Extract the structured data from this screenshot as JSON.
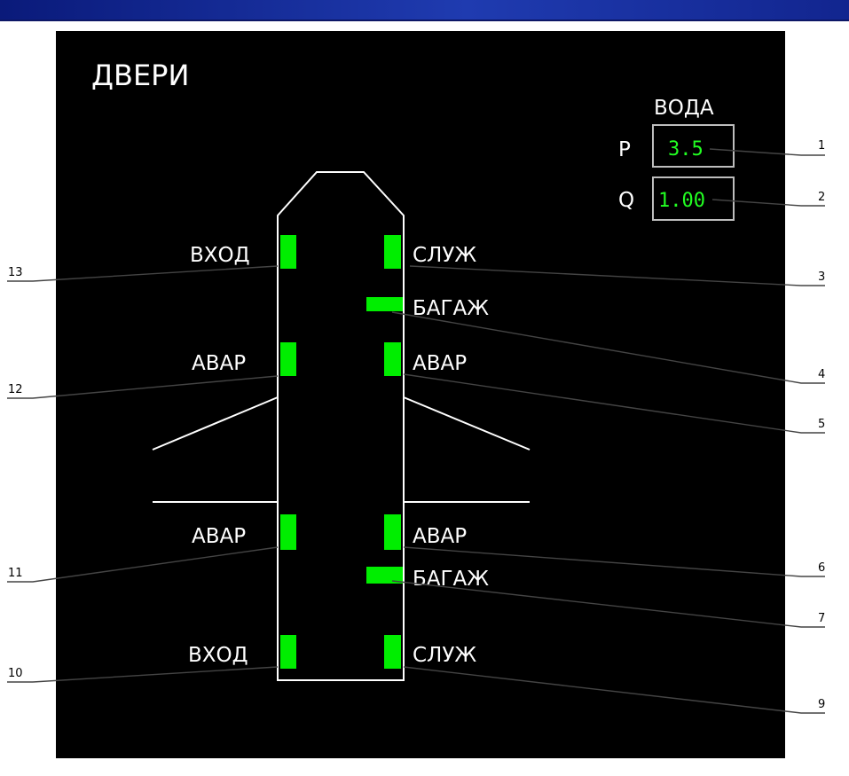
{
  "title": "ДВЕРИ",
  "water": {
    "label": "ВОДА",
    "p": {
      "label": "P",
      "value": "3.5"
    },
    "q": {
      "label": "Q",
      "value": "1.00"
    }
  },
  "doors": {
    "front_left": "ВХОД",
    "front_right": "СЛУЖ",
    "baggage_front": "БАГАЖ",
    "emerg_fwd_left": "АВАР",
    "emerg_fwd_right": "АВАР",
    "emerg_aft_left": "АВАР",
    "emerg_aft_right": "АВАР",
    "baggage_aft": "БАГАЖ",
    "rear_left": "ВХОД",
    "rear_right": "СЛУЖ"
  },
  "callouts": [
    "1",
    "2",
    "3",
    "4",
    "5",
    "6",
    "7",
    "9",
    "10",
    "11",
    "12",
    "13"
  ],
  "colors": {
    "panel": "#000000",
    "outline": "#ffffff",
    "indicator_closed": "#00ee00",
    "value_text": "#22ff22",
    "value_box": "#bdbdbd",
    "leader_line": "#444444",
    "title_bar": "#1f3bb0"
  }
}
